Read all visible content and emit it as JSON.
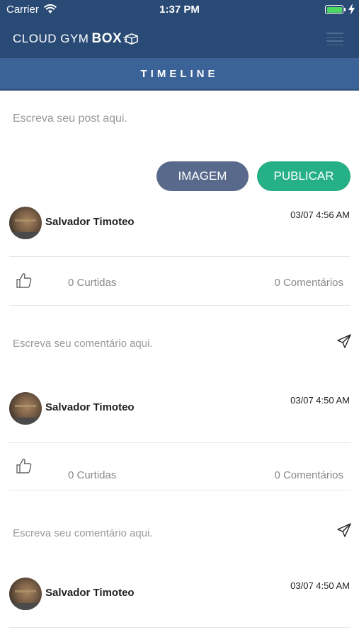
{
  "status_bar": {
    "carrier": "Carrier",
    "time": "1:37 PM",
    "battery_level": 1.0
  },
  "header": {
    "logo_text": "CLOUD GYM",
    "logo_bold": "BOX"
  },
  "page": {
    "title": "TIMELINE"
  },
  "composer": {
    "placeholder": "Escreva seu post aqui.",
    "image_button": "IMAGEM",
    "publish_button": "PUBLICAR"
  },
  "posts": [
    {
      "author": "Salvador Timoteo",
      "time": "03/07 4:56 AM",
      "likes": "0 Curtidas",
      "comments": "0 Comentários",
      "comment_placeholder": "Escreva seu comentário aqui."
    },
    {
      "author": "Salvador Timoteo",
      "time": "03/07 4:50 AM",
      "likes": "0 Curtidas",
      "comments": "0 Comentários",
      "comment_placeholder": "Escreva seu comentário aqui."
    },
    {
      "author": "Salvador Timoteo",
      "time": "03/07 4:50 AM"
    }
  ],
  "colors": {
    "header_bg": "#294a74",
    "title_bar_bg": "#3b6397",
    "image_button_bg": "#58698c",
    "publish_button_bg": "#25b088"
  }
}
